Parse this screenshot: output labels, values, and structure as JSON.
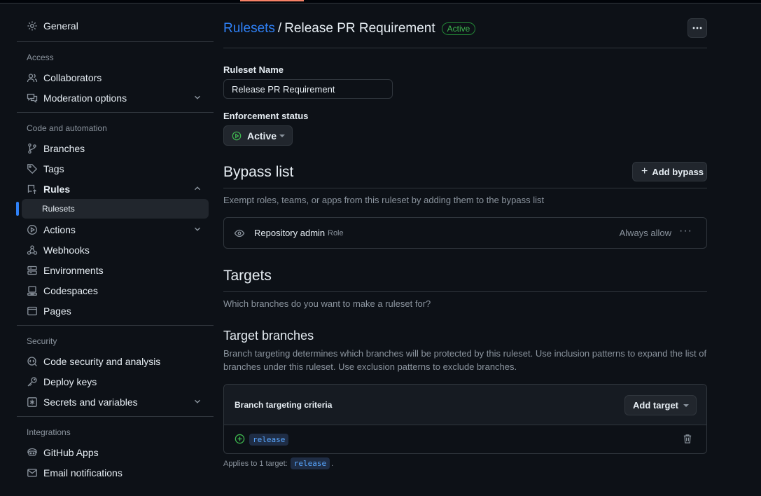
{
  "sidebar": {
    "general": "General",
    "access_label": "Access",
    "collaborators": "Collaborators",
    "moderation": "Moderation options",
    "code_label": "Code and automation",
    "branches": "Branches",
    "tags": "Tags",
    "rules": "Rules",
    "rulesets": "Rulesets",
    "actions": "Actions",
    "webhooks": "Webhooks",
    "environments": "Environments",
    "codespaces": "Codespaces",
    "pages": "Pages",
    "security_label": "Security",
    "code_security": "Code security and analysis",
    "deploy_keys": "Deploy keys",
    "secrets": "Secrets and variables",
    "integrations_label": "Integrations",
    "github_apps": "GitHub Apps",
    "email_notifications": "Email notifications"
  },
  "header": {
    "breadcrumb_link": "Rulesets",
    "separator": "/",
    "title": "Release PR Requirement",
    "status_badge": "Active"
  },
  "form": {
    "name_label": "Ruleset Name",
    "name_value": "Release PR Requirement",
    "enforcement_label": "Enforcement status",
    "enforcement_value": "Active"
  },
  "bypass": {
    "heading": "Bypass list",
    "add_button": "Add bypass",
    "description": "Exempt roles, teams, or apps from this ruleset by adding them to the bypass list",
    "entries": [
      {
        "name": "Repository admin",
        "type": "Role",
        "mode": "Always allow"
      }
    ]
  },
  "targets": {
    "heading": "Targets",
    "description": "Which branches do you want to make a ruleset for?",
    "branches_heading": "Target branches",
    "branches_description": "Branch targeting determines which branches will be protected by this ruleset. Use inclusion patterns to expand the list of branches under this ruleset. Use exclusion patterns to exclude branches.",
    "criteria_title": "Branch targeting criteria",
    "add_target_button": "Add target",
    "patterns": [
      "release"
    ],
    "applies_prefix": "Applies to 1 target:",
    "applies_target": "release",
    "applies_suffix": "."
  },
  "colors": {
    "background": "#0d1117",
    "accent": "#2f81f7",
    "success": "#3fb950",
    "muted": "#8b949e",
    "border": "#30363d"
  },
  "icons": {
    "general": "gear-icon",
    "collaborators": "people-icon",
    "moderation": "comment-discussion-icon",
    "branches": "git-branch-icon",
    "tags": "tag-icon",
    "rules": "repo-push-icon",
    "actions": "play-icon",
    "webhooks": "webhook-icon",
    "environments": "server-icon",
    "codespaces": "codespaces-icon",
    "pages": "browser-icon",
    "code_security": "codescan-icon",
    "deploy_keys": "key-icon",
    "secrets": "asterisk-icon",
    "github_apps": "apps-icon",
    "email": "mail-icon"
  }
}
